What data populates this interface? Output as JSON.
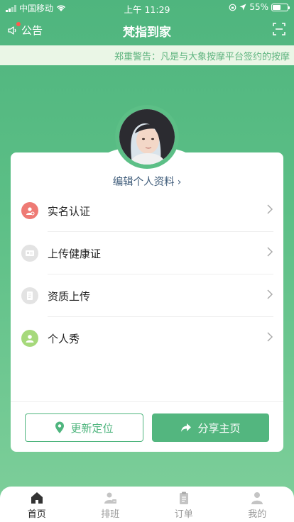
{
  "status_bar": {
    "carrier": "中国移动",
    "time": "上午 11:29",
    "battery": "55%",
    "battery_level": 0.55,
    "icons": [
      "signal-icon",
      "wifi-icon",
      "lock-rotation-icon",
      "location-icon",
      "battery-icon"
    ]
  },
  "header": {
    "notice_label": "公告",
    "title": "梵指到家",
    "scan_icon": "scan-icon"
  },
  "marquee": {
    "text": "郑重警告：凡是与大象按摩平台签约的按摩"
  },
  "profile": {
    "edit_label": "编辑个人资料"
  },
  "menu": {
    "items": [
      {
        "label": "实名认证",
        "icon": "id-verify-icon",
        "color": "#ee7a74"
      },
      {
        "label": "上传健康证",
        "icon": "health-card-icon",
        "color": "#e3e3e3"
      },
      {
        "label": "资质上传",
        "icon": "document-icon",
        "color": "#e3e3e3"
      },
      {
        "label": "个人秀",
        "icon": "person-icon",
        "color": "#a6d97b"
      }
    ]
  },
  "actions": {
    "relocate_label": "更新定位",
    "share_label": "分享主页"
  },
  "tabbar": {
    "tabs": [
      {
        "label": "首页",
        "icon": "home-icon",
        "active": true
      },
      {
        "label": "排班",
        "icon": "schedule-icon",
        "active": false
      },
      {
        "label": "订单",
        "icon": "clipboard-icon",
        "active": false
      },
      {
        "label": "我的",
        "icon": "user-icon",
        "active": false
      }
    ]
  },
  "colors": {
    "brand_green": "#4fb57e",
    "marquee_bg": "#eaf6e6",
    "marquee_text": "#5fb47f"
  }
}
